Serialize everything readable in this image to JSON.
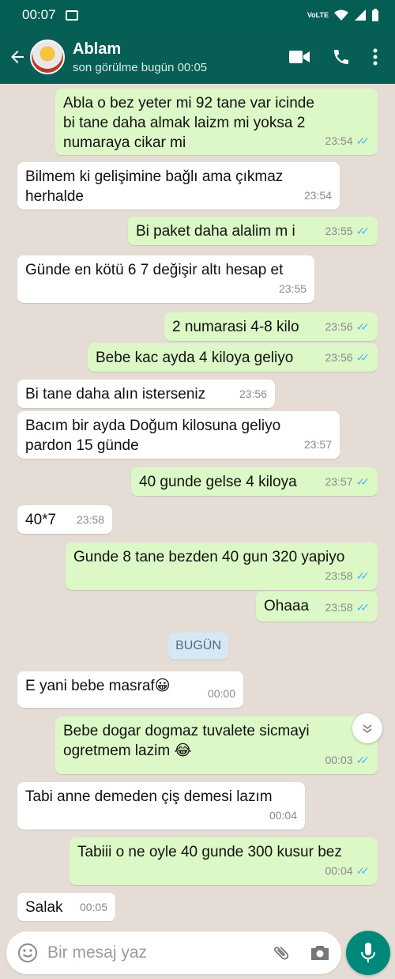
{
  "status_bar": {
    "time": "00:07",
    "network": "VoLTE"
  },
  "header": {
    "name": "Ablam",
    "last_seen": "son görülme bugün 00:05"
  },
  "messages": [
    {
      "dir": "out",
      "text": "Abla o bez yeter mi 92 tane var icinde\nbi tane daha almak laizm mi yoksa 2\nnumaraya cikar mi",
      "time": "23:54"
    },
    {
      "dir": "in",
      "text": "Bilmem ki gelişimine bağlı ama çıkmaz\nherhalde",
      "time": "23:54"
    },
    {
      "dir": "out",
      "text": "Bi paket daha alalim m i",
      "time": "23:55"
    },
    {
      "dir": "in",
      "text": "Günde en kötü 6 7 değişir altı hesap et",
      "time": "23:55"
    },
    {
      "dir": "out",
      "text": "2 numarasi 4-8 kilo",
      "time": "23:56"
    },
    {
      "dir": "out",
      "text": "Bebe kac ayda 4 kiloya geliyo",
      "time": "23:56"
    },
    {
      "dir": "in",
      "text": "Bi tane daha alın isterseniz",
      "time": "23:56"
    },
    {
      "dir": "in",
      "text": "Bacım bir ayda Doğum kilosuna geliyo\npardon 15 günde",
      "time": "23:57"
    },
    {
      "dir": "out",
      "text": "40 gunde gelse 4 kiloya",
      "time": "23:57"
    },
    {
      "dir": "in",
      "text": "40*7",
      "time": "23:58"
    },
    {
      "dir": "out",
      "text": "Gunde 8 tane bezden 40 gun 320 yapiyo",
      "time": "23:58"
    },
    {
      "dir": "out",
      "text": "Ohaaa",
      "time": "23:58"
    },
    {
      "dir": "in",
      "text": "E yani bebe masraf😀",
      "time": "00:00"
    },
    {
      "dir": "out",
      "text": "Bebe dogar dogmaz tuvalete sicmayi\nogretmem lazim 😂",
      "time": "00:03"
    },
    {
      "dir": "in",
      "text": "Tabi anne demeden çiş demesi lazım",
      "time": "00:04"
    },
    {
      "dir": "out",
      "text": "Tabiii o ne oyle 40 gunde 300 kusur bez",
      "time": "00:04"
    },
    {
      "dir": "in",
      "text": "Salak",
      "time": "00:05"
    }
  ],
  "day_chip": "BUGÜN",
  "composer": {
    "placeholder": "Bir mesaj yaz"
  },
  "colors": {
    "header": "#075e54",
    "outgoing": "#dcf8c6",
    "incoming": "#ffffff",
    "fab": "#00897b",
    "read_tick": "#4fb6ec"
  }
}
